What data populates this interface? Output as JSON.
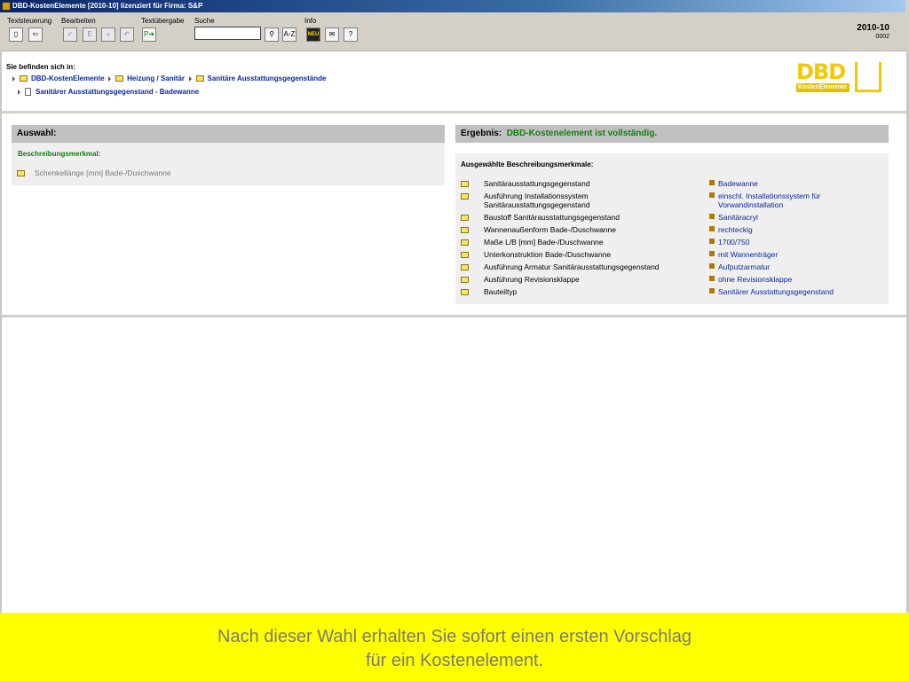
{
  "window": {
    "title": "DBD-KostenElemente [2010-10] lizenziert für Firma: S&P"
  },
  "toolbar": {
    "groups": [
      "Textsteuerung",
      "Bearbeiten",
      "Textübergabe",
      "Suche",
      "Info"
    ],
    "search_value": "",
    "search_btn_az": "A-Z",
    "info_neu": "NEU"
  },
  "version": {
    "year": "2010-10",
    "build": "0002"
  },
  "breadcrumb": {
    "label": "Sie befinden sich in:",
    "items": [
      "DBD-KostenElemente",
      "Heizung / Sanitär",
      "Sanitäre Ausstattungsgegenstände"
    ],
    "current": "Sanitärer Ausstattungsgegenstand - Badewanne"
  },
  "logo": {
    "big": "DBD",
    "sub": "KostenElemente"
  },
  "auswahl": {
    "header": "Auswahl:",
    "section": "Beschreibungsmerkmal:",
    "item": "Schenkellänge [mm] Bade-/Duschwanne"
  },
  "ergebnis": {
    "label": "Ergebnis:",
    "status": "DBD-Kostenelement ist vollständig.",
    "section": "Ausgewählte Beschreibungsmerkmale:",
    "rows": [
      {
        "name": "Sanitärausstattungsgegenstand",
        "value": "Badewanne"
      },
      {
        "name": "Ausführung Installationssystem",
        "name2": "Sanitärausstattungsgegenstand",
        "value": "einschl. Installationssystem für",
        "value2": "Vorwandinstallation"
      },
      {
        "name": "Baustoff Sanitärausstattungsgegenstand",
        "value": "Sanitäracryl"
      },
      {
        "name": "Wannenaußenform Bade-/Duschwanne",
        "value": "rechteckig"
      },
      {
        "name": "Maße L/B [mm] Bade-/Duschwanne",
        "value": "1700/750"
      },
      {
        "name": "Unterkonstruktion Bade-/Duschwanne",
        "value": "mit Wannenträger"
      },
      {
        "name": "Ausführung Armatur Sanitärausstattungsgegenstand",
        "value": "Aufputzarmatur"
      },
      {
        "name": "Ausführung Revisionsklappe",
        "value": "ohne Revisionsklappe"
      },
      {
        "name": "Bauteiltyp",
        "value": "Sanitärer Ausstattungsgegenstand"
      }
    ]
  },
  "caption": {
    "line1": "Nach dieser Wahl erhalten Sie sofort einen ersten Vorschlag",
    "line2": "für ein Kostenelement."
  },
  "colors": {
    "titlebar": "#0a246a",
    "highlight": "#ffff00",
    "status_green": "#108010",
    "link_blue": "#0a2a9a"
  }
}
